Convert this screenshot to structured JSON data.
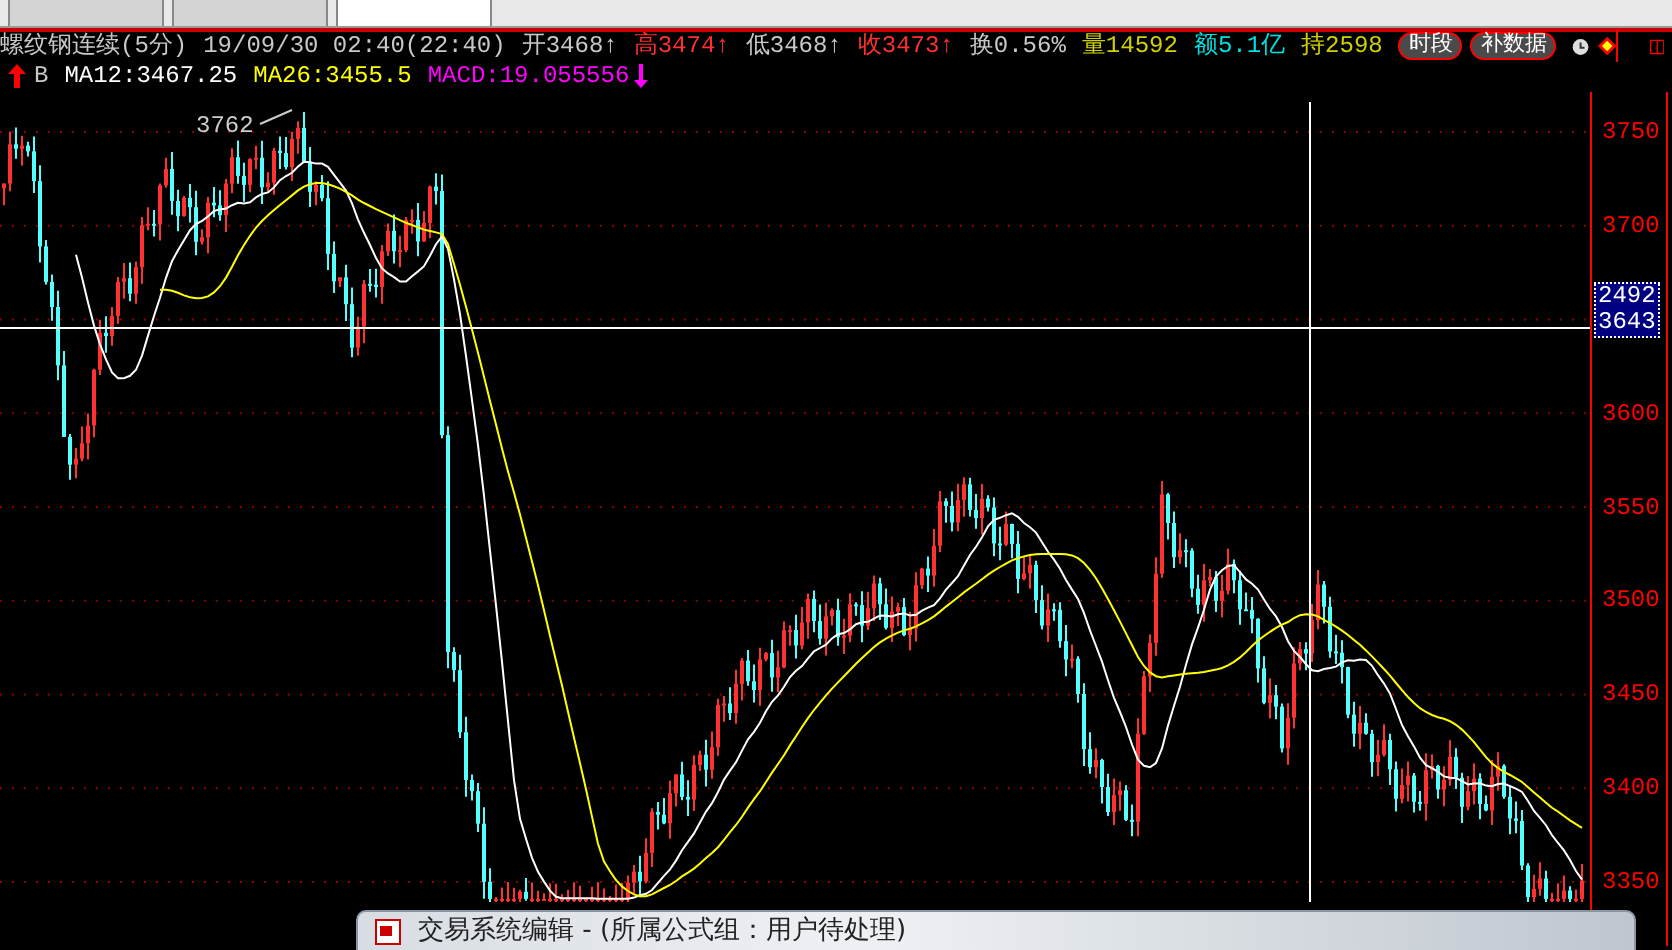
{
  "tabs": [
    {
      "selected": false
    },
    {
      "selected": false
    },
    {
      "selected": true
    }
  ],
  "header": {
    "title": "螺纹钢连续(5分)",
    "datetime": "19/09/30 02:40(22:40)",
    "quotes": [
      {
        "label": "开",
        "value": "3468",
        "arrow": "↑",
        "color": "#c8c8c8"
      },
      {
        "label": "高",
        "value": "3474",
        "arrow": "↑",
        "color": "#ff3030"
      },
      {
        "label": "低",
        "value": "3468",
        "arrow": "↑",
        "color": "#c8c8c8"
      },
      {
        "label": "收",
        "value": "3473",
        "arrow": "↑",
        "color": "#ff3030"
      },
      {
        "label": "换",
        "value": "0.56%",
        "color": "#c8c8c8"
      },
      {
        "label": "量",
        "value": "14592",
        "color": "#d0d000"
      },
      {
        "label": "额",
        "value": "5.1亿",
        "color": "#00e0e0"
      },
      {
        "label": "持",
        "value": "2598",
        "color": "#d0d000"
      }
    ],
    "buttons": [
      "时段",
      "补数据"
    ]
  },
  "indicators": {
    "signal": "B",
    "values": [
      {
        "text": "MA12:3467.25",
        "color": "#ffffff"
      },
      {
        "text": "MA26:3455.5",
        "color": "#ffff00"
      },
      {
        "text": "MACD:19.055556",
        "color": "#ff00ff"
      }
    ]
  },
  "axis": {
    "ticks": [
      "3750",
      "3700",
      "3600",
      "3550",
      "3500",
      "3450",
      "3400",
      "3350"
    ]
  },
  "crosshair": {
    "readout": [
      "2492",
      "3643"
    ]
  },
  "max_label": "3762",
  "editor_window": {
    "title": "交易系统编辑 - (所属公式组：用户待处理)"
  }
}
